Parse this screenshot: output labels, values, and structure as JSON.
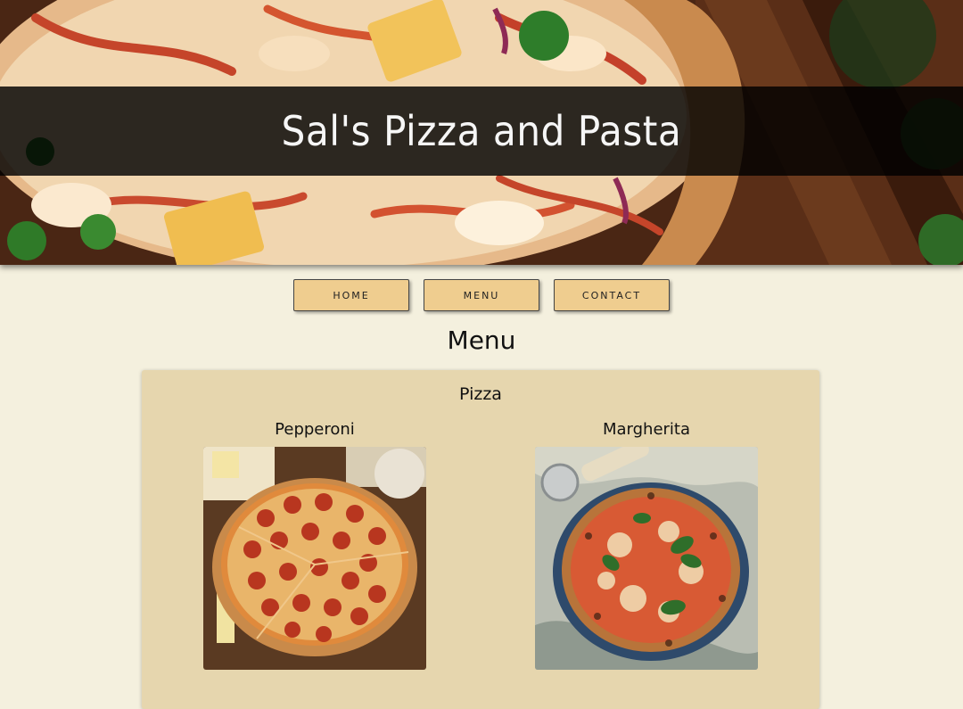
{
  "hero": {
    "title": "Sal's Pizza and Pasta"
  },
  "nav": {
    "items": [
      {
        "label": "HOME"
      },
      {
        "label": "MENU"
      },
      {
        "label": "CONTACT"
      }
    ]
  },
  "main": {
    "heading": "Menu",
    "sections": [
      {
        "title": "Pizza",
        "items": [
          {
            "name": "Pepperoni"
          },
          {
            "name": "Margherita"
          }
        ]
      }
    ]
  },
  "colors": {
    "page_background": "#f4f0de",
    "card_background": "#e6d6ae",
    "nav_button": "#efcd8f",
    "hero_band": "#000000"
  }
}
